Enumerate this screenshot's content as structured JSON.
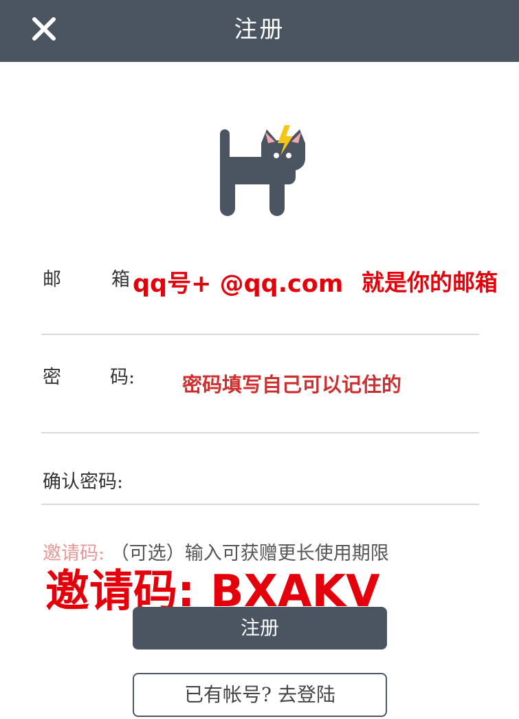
{
  "header": {
    "title": "注册",
    "close_icon": "close-icon"
  },
  "logo": {
    "icon": "black-cat-lightning-logo",
    "colors": {
      "body": "#4b5562",
      "ear": "#f4a7ae",
      "bolt": "#f5c518"
    }
  },
  "form": {
    "email_label_1": "邮",
    "email_label_2": "箱",
    "password_label_1": "密",
    "password_label_2": "码:",
    "confirm_label": "确认密码:",
    "invite_label": "邀请码:",
    "invite_hint": "（可选）输入可获赠更长使用期限"
  },
  "annotations": {
    "email_overlay": "qq号+ @qq.com",
    "email_overlay_2": "就是你的邮箱",
    "password_hint": "密码填写自己可以记住的",
    "invite_code": "邀请码: BXAKV"
  },
  "buttons": {
    "register": "注册",
    "login": "已有帐号? 去登陆"
  },
  "colors": {
    "header_bg": "#4b5562",
    "accent_red": "#e3000b",
    "invite_label": "#e79898"
  }
}
